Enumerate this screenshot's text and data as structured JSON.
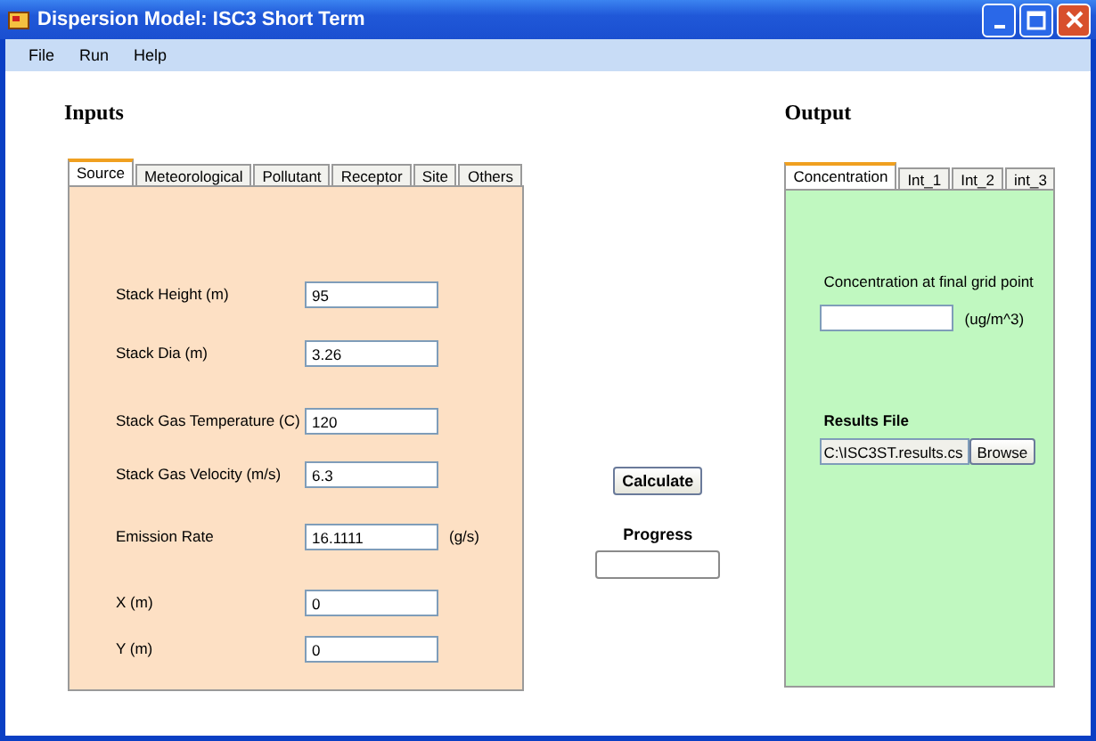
{
  "window": {
    "title": "Dispersion Model: ISC3 Short Term"
  },
  "menu": [
    "File",
    "Run",
    "Help"
  ],
  "inputs": {
    "heading": "Inputs",
    "tabs": [
      {
        "label": "Source",
        "selected": true
      },
      {
        "label": "Meteorological",
        "selected": false
      },
      {
        "label": "Pollutant",
        "selected": false
      },
      {
        "label": "Receptor",
        "selected": false
      },
      {
        "label": "Site",
        "selected": false
      },
      {
        "label": "Others",
        "selected": false
      }
    ],
    "fields": [
      {
        "label": "Stack Height (m)",
        "value": "95"
      },
      {
        "label": "Stack Dia (m)",
        "value": "3.26"
      },
      {
        "label": "Stack Gas Temperature (C)",
        "value": "120"
      },
      {
        "label": "Stack Gas Velocity (m/s)",
        "value": "6.3"
      },
      {
        "label": "Emission Rate",
        "value": "16.1111",
        "unit": "(g/s)"
      },
      {
        "label": "X  (m)",
        "value": "0"
      },
      {
        "label": "Y (m)",
        "value": "0"
      }
    ]
  },
  "actions": {
    "calculate": "Calculate",
    "progress_label": "Progress",
    "progress": {
      "level": 0
    }
  },
  "output": {
    "heading": "Output",
    "tabs": [
      {
        "label": "Concentration",
        "selected": true
      },
      {
        "label": "Int_1",
        "selected": false
      },
      {
        "label": "Int_2",
        "selected": false
      },
      {
        "label": "int_3",
        "selected": false
      }
    ],
    "concentration_label": "Concentration at final grid point",
    "concentration_unit": "(ug/m^3)",
    "results_label": "Results File",
    "results_path": "C:\\ISC3ST.results.cs",
    "browse": "Browse"
  }
}
